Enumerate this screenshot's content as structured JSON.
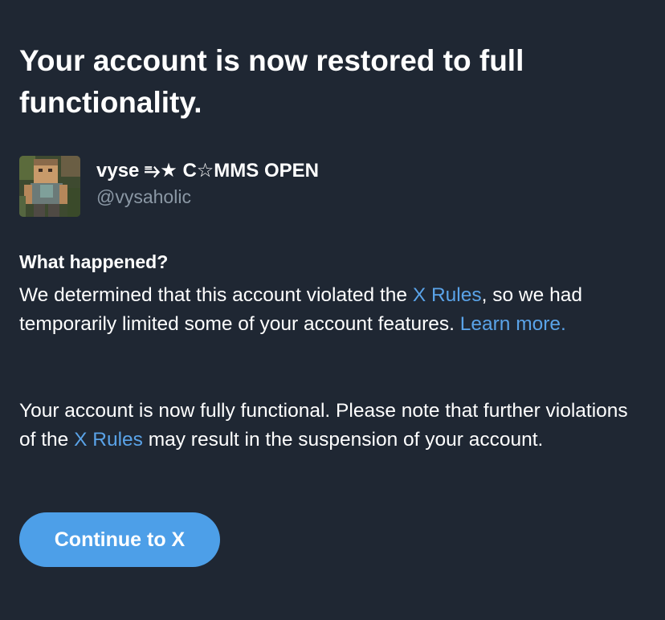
{
  "title": {
    "line1": "Your account is now restored to full",
    "line2": "functionality."
  },
  "account": {
    "display_name": "vyse ⥱★ C☆MMS OPEN",
    "handle": "@vysaholic",
    "avatar_icon": "minecraft-skin-avatar"
  },
  "what_happened": {
    "heading": "What happened?",
    "p1_before": "We determined that this account violated the ",
    "p1_link": "X Rules",
    "p1_middle": ", so we had temporarily limited some of your account features. ",
    "p1_learn_more": "Learn more."
  },
  "status": {
    "p2_before": "Your account is now fully functional. Please note that further violations of the ",
    "p2_link": "X Rules",
    "p2_after": " may result in the suspension of your account."
  },
  "actions": {
    "continue_label": "Continue to X"
  },
  "colors": {
    "background": "#1f2733",
    "link": "#5aa3e8",
    "button": "#4d9fe8",
    "muted": "#8b98a5"
  }
}
